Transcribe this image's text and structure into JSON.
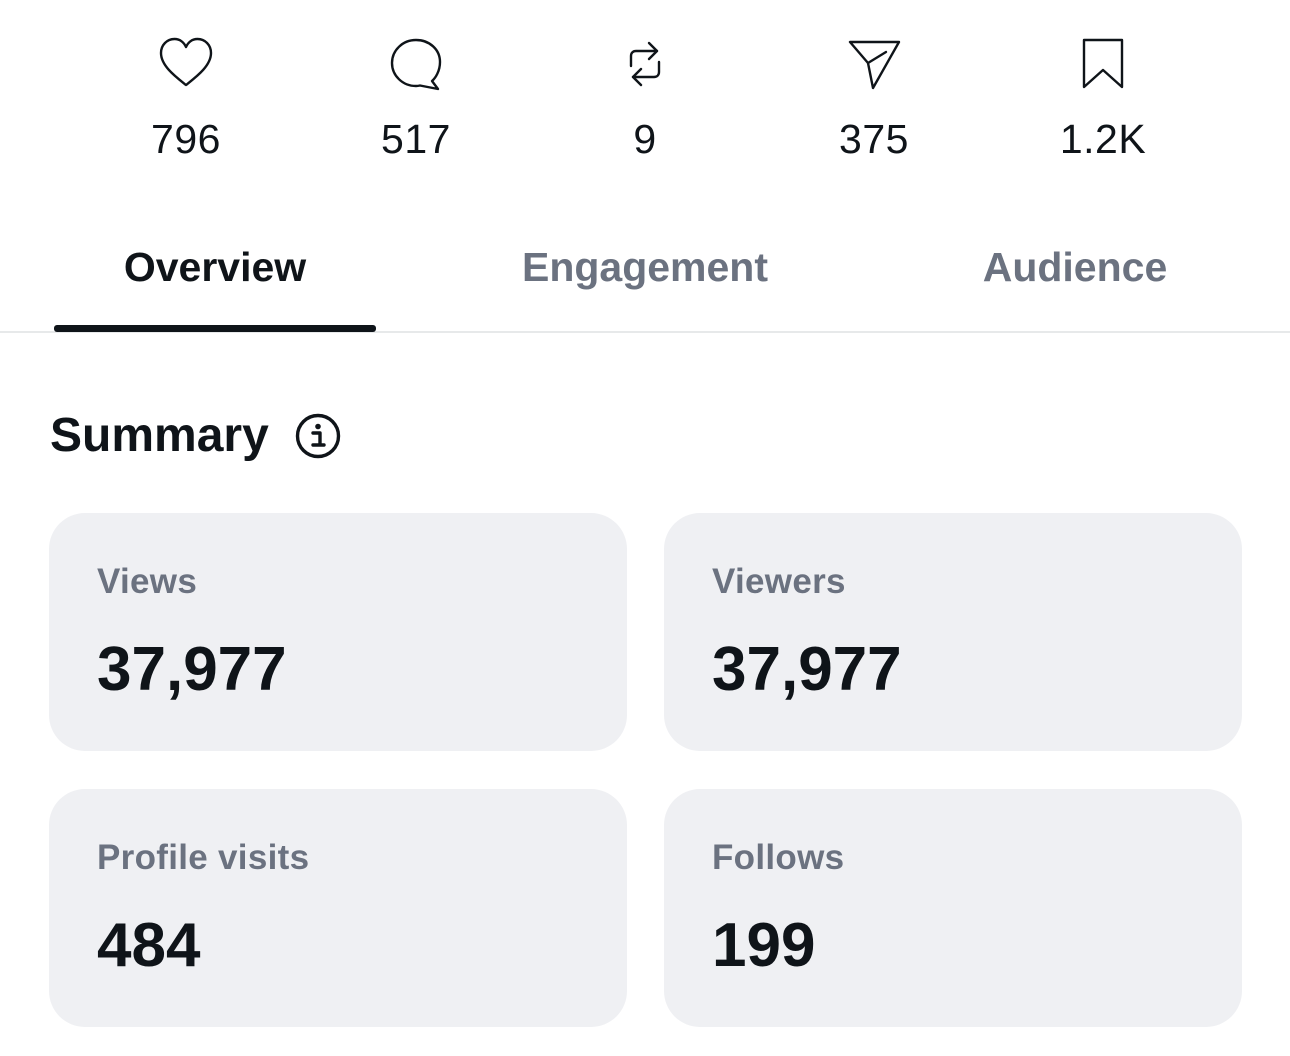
{
  "stats": [
    {
      "icon": "heart-icon",
      "count": "796"
    },
    {
      "icon": "comment-icon",
      "count": "517"
    },
    {
      "icon": "repost-icon",
      "count": "9"
    },
    {
      "icon": "share-icon",
      "count": "375"
    },
    {
      "icon": "bookmark-icon",
      "count": "1.2K"
    }
  ],
  "tabs": [
    {
      "label": "Overview",
      "active": true
    },
    {
      "label": "Engagement",
      "active": false
    },
    {
      "label": "Audience",
      "active": false
    }
  ],
  "summary": {
    "title": "Summary",
    "info_icon": "info-icon",
    "cards": [
      {
        "label": "Views",
        "value": "37,977"
      },
      {
        "label": "Viewers",
        "value": "37,977"
      },
      {
        "label": "Profile visits",
        "value": "484"
      },
      {
        "label": "Follows",
        "value": "199"
      }
    ]
  },
  "colors": {
    "text_primary": "#0f1419",
    "text_secondary": "#6b7280",
    "card_background": "#eff0f3",
    "divider": "#e7e9ea"
  }
}
